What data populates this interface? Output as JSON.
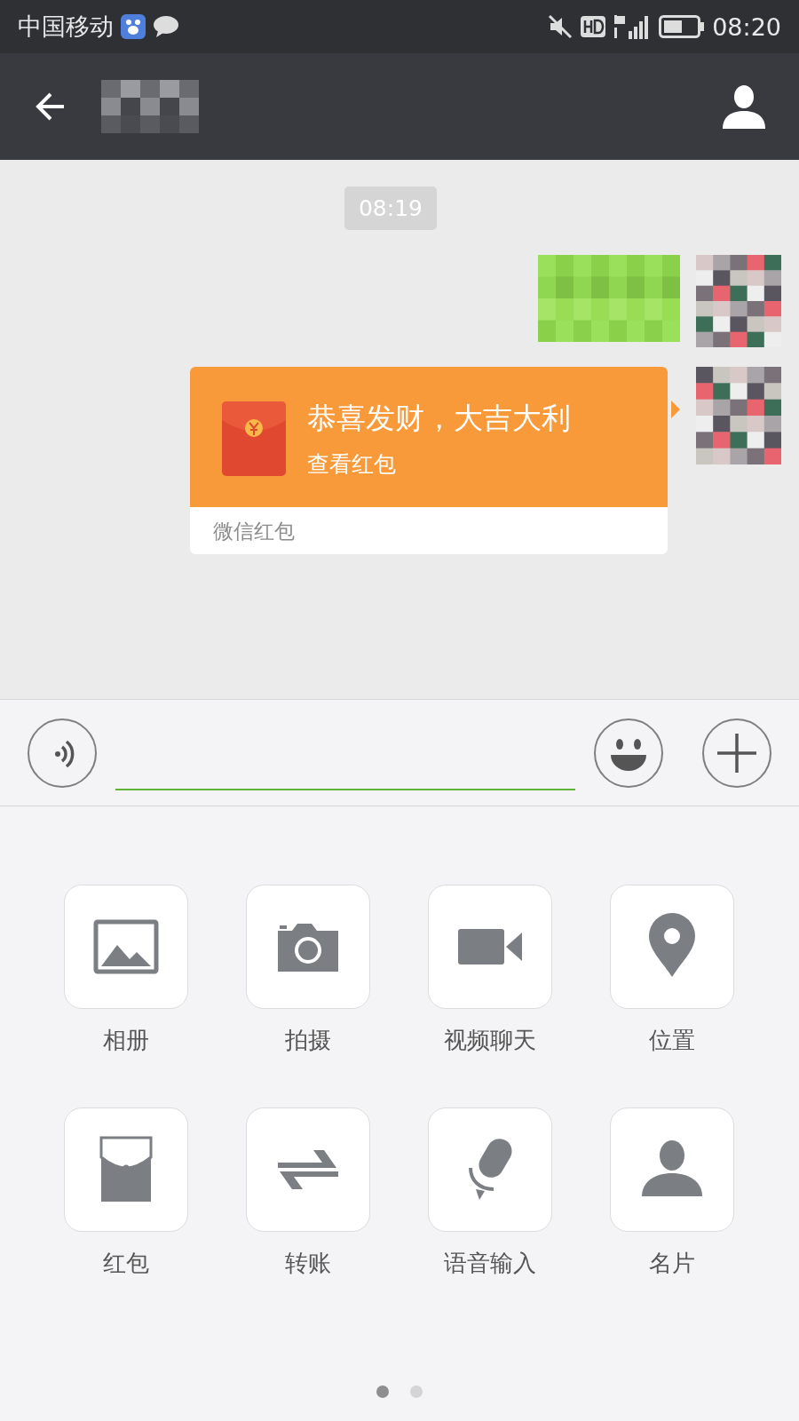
{
  "status_bar": {
    "carrier": "中国移动",
    "time": "08:20"
  },
  "chat": {
    "timestamp": "08:19",
    "messages": [
      {
        "kind": "text"
      },
      {
        "kind": "red_packet",
        "title": "恭喜发财，大吉大利",
        "action": "查看红包",
        "footer": "微信红包"
      }
    ]
  },
  "panel": {
    "items": [
      {
        "label": "相册"
      },
      {
        "label": "拍摄"
      },
      {
        "label": "视频聊天"
      },
      {
        "label": "位置"
      },
      {
        "label": "红包"
      },
      {
        "label": "转账"
      },
      {
        "label": "语音输入"
      },
      {
        "label": "名片"
      }
    ],
    "pages": [
      {
        "selected": true
      },
      {
        "selected": false
      }
    ]
  }
}
